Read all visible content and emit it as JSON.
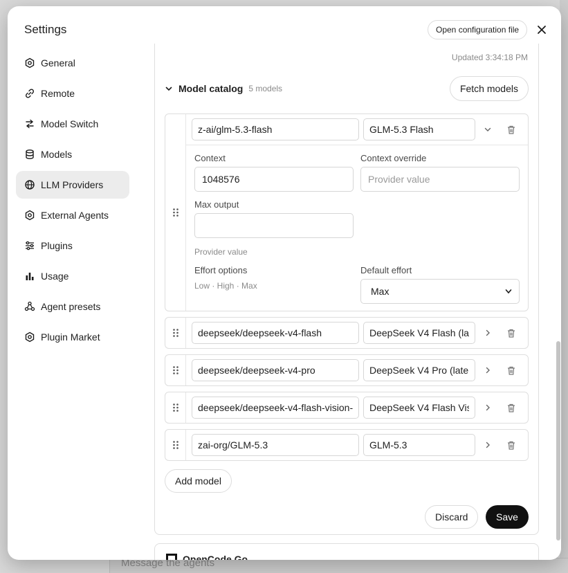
{
  "modal": {
    "title": "Settings",
    "open_config_label": "Open configuration file"
  },
  "sidebar": {
    "items": [
      {
        "label": "General",
        "icon": "gear-icon"
      },
      {
        "label": "Remote",
        "icon": "link-icon"
      },
      {
        "label": "Model Switch",
        "icon": "switch-icon"
      },
      {
        "label": "Models",
        "icon": "database-icon"
      },
      {
        "label": "LLM Providers",
        "icon": "globe-icon",
        "active": true
      },
      {
        "label": "External Agents",
        "icon": "gear-icon"
      },
      {
        "label": "Plugins",
        "icon": "sliders-icon"
      },
      {
        "label": "Usage",
        "icon": "bar-chart-icon"
      },
      {
        "label": "Agent presets",
        "icon": "agents-icon"
      },
      {
        "label": "Plugin Market",
        "icon": "gear-icon"
      }
    ]
  },
  "provider": {
    "updated": "Updated 3:34:18 PM"
  },
  "catalog": {
    "title": "Model catalog",
    "count": "5 models",
    "fetch_label": "Fetch models",
    "models": [
      {
        "id": "z-ai/glm-5.3-flash",
        "name": "GLM-5.3 Flash",
        "expanded": true
      },
      {
        "id": "deepseek/deepseek-v4-flash",
        "name": "DeepSeek V4 Flash (la"
      },
      {
        "id": "deepseek/deepseek-v4-pro",
        "name": "DeepSeek V4 Pro (late"
      },
      {
        "id": "deepseek/deepseek-v4-flash-vision-",
        "name": "DeepSeek V4 Flash Vis"
      },
      {
        "id": "zai-org/GLM-5.3",
        "name": "GLM-5.3"
      }
    ],
    "expanded": {
      "context_label": "Context",
      "context_value": "1048576",
      "context_override_label": "Context override",
      "context_override_placeholder": "Provider value",
      "max_output_label": "Max output",
      "max_output_value": "",
      "max_output_hint": "Provider value",
      "effort_options_label": "Effort options",
      "effort_options_value": "Low · High · Max",
      "default_effort_label": "Default effort",
      "default_effort_value": "Max"
    },
    "add_model_label": "Add model"
  },
  "actions": {
    "discard_label": "Discard",
    "save_label": "Save"
  },
  "next_section": {
    "title": "OpenCode Go"
  },
  "background": {
    "message_placeholder": "Message the agents"
  }
}
